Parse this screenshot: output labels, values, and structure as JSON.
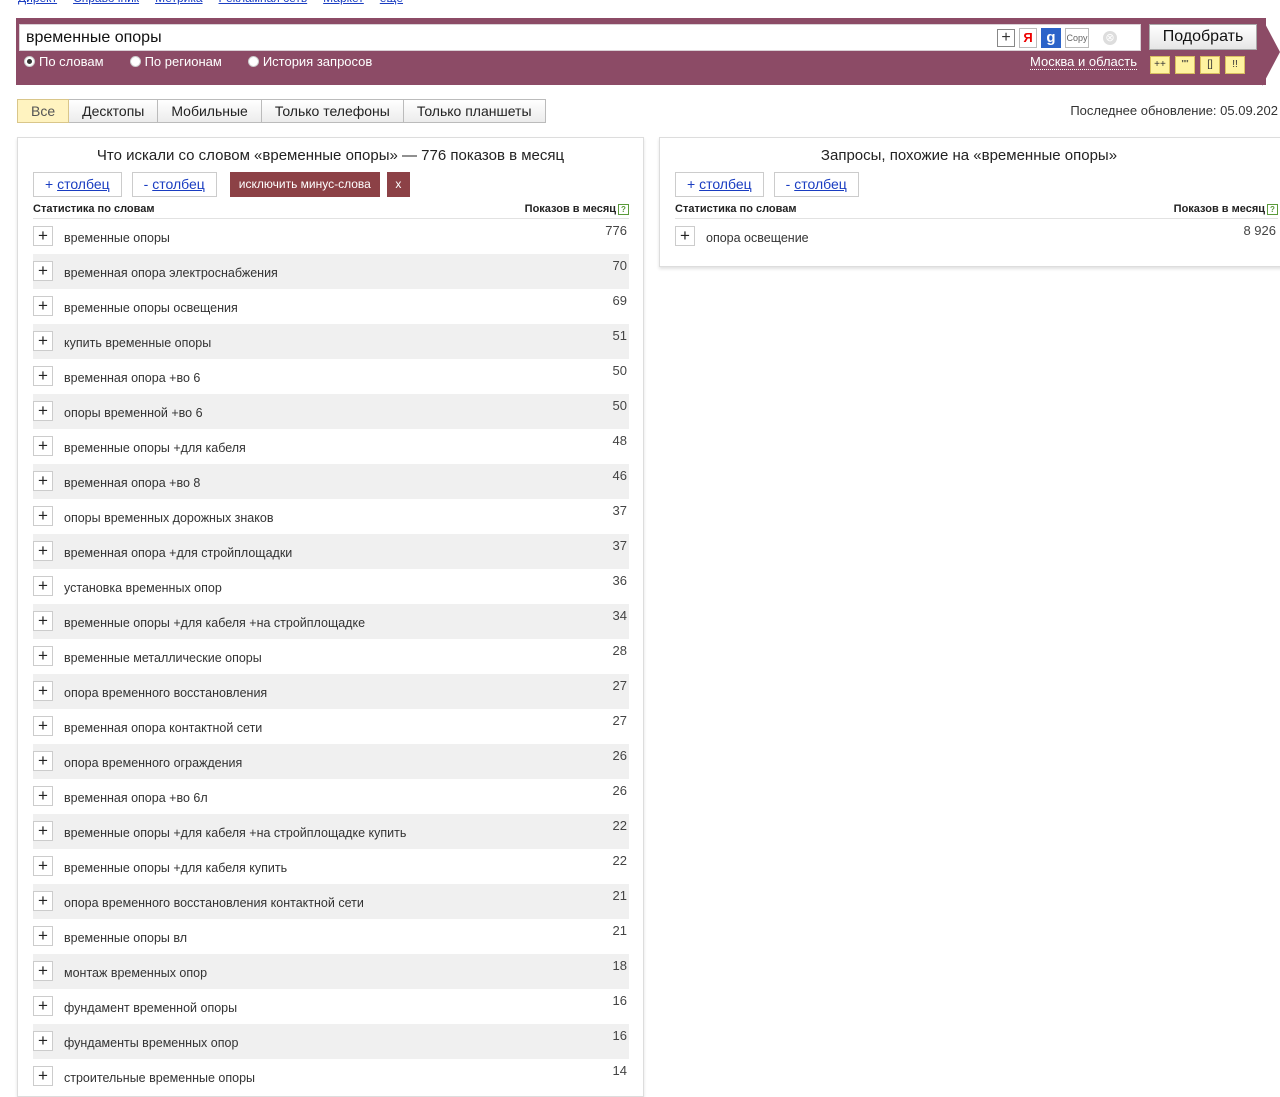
{
  "topnav": [
    "Директ",
    "Справочник",
    "Метрика",
    "Рекламная сеть",
    "Маркет",
    "ещё"
  ],
  "search": {
    "value": "временные опоры",
    "pick_label": "Подобрать",
    "tools": {
      "plus": "+",
      "ya": "Я",
      "g": "g",
      "copy": "Copy",
      "clear": "⊗"
    },
    "modes": [
      "По словам",
      "По регионам",
      "История запросов"
    ],
    "selected_mode": "По словам",
    "region": "Москва и область",
    "format_buttons": [
      "++",
      "\"\"",
      "[]",
      "!!"
    ]
  },
  "tabs": [
    "Все",
    "Десктопы",
    "Мобильные",
    "Только телефоны",
    "Только планшеты"
  ],
  "active_tab": "Все",
  "last_update": "Последнее обновление: 05.09.202",
  "left_panel": {
    "title": "Что искали со словом «временные опоры» — 776 показов в месяц",
    "add_column": "столбец",
    "remove_column": "столбец",
    "exclude_label": "исключить минус-слова",
    "close_label": "x",
    "col_left": "Статистика по словам",
    "col_right": "Показов в месяц",
    "rows": [
      {
        "phrase": "временные опоры",
        "count": "776"
      },
      {
        "phrase": "временная опора электроснабжения",
        "count": "70"
      },
      {
        "phrase": "временные опоры освещения",
        "count": "69"
      },
      {
        "phrase": "купить временные опоры",
        "count": "51"
      },
      {
        "phrase": "временная опора +во 6",
        "count": "50"
      },
      {
        "phrase": "опоры временной +во 6",
        "count": "50"
      },
      {
        "phrase": "временные опоры +для кабеля",
        "count": "48"
      },
      {
        "phrase": "временная опора +во 8",
        "count": "46"
      },
      {
        "phrase": "опоры временных дорожных знаков",
        "count": "37"
      },
      {
        "phrase": "временная опора +для стройплощадки",
        "count": "37"
      },
      {
        "phrase": "установка временных опор",
        "count": "36"
      },
      {
        "phrase": "временные опоры +для кабеля +на стройплощадке",
        "count": "34"
      },
      {
        "phrase": "временные металлические опоры",
        "count": "28"
      },
      {
        "phrase": "опора временного восстановления",
        "count": "27"
      },
      {
        "phrase": "временная опора контактной сети",
        "count": "27"
      },
      {
        "phrase": "опора временного ограждения",
        "count": "26"
      },
      {
        "phrase": "временная опора +во 6л",
        "count": "26"
      },
      {
        "phrase": "временные опоры +для кабеля +на стройплощадке купить",
        "count": "22"
      },
      {
        "phrase": "временные опоры +для кабеля купить",
        "count": "22"
      },
      {
        "phrase": "опора временного восстановления контактной сети",
        "count": "21"
      },
      {
        "phrase": "временные опоры вл",
        "count": "21"
      },
      {
        "phrase": "монтаж временных опор",
        "count": "18"
      },
      {
        "phrase": "фундамент временной опоры",
        "count": "16"
      },
      {
        "phrase": "фундаменты временных опор",
        "count": "16"
      },
      {
        "phrase": "строительные временные опоры",
        "count": "14"
      }
    ]
  },
  "right_panel": {
    "title": "Запросы, похожие на «временные опоры»",
    "add_column": "столбец",
    "remove_column": "столбец",
    "col_left": "Статистика по словам",
    "col_right": "Показов в месяц",
    "rows": [
      {
        "phrase": "опора освещение",
        "count": "8 926"
      }
    ]
  }
}
